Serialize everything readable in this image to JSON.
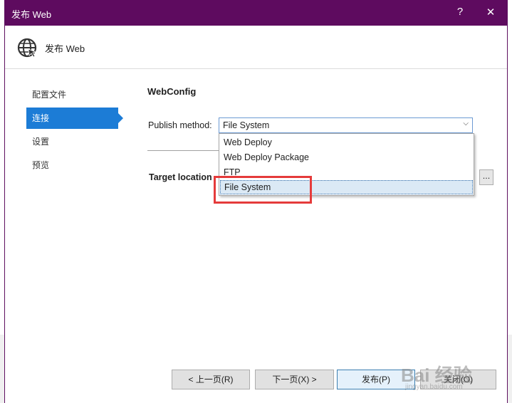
{
  "window": {
    "title": "发布 Web",
    "help_glyph": "?",
    "close_glyph": "✕"
  },
  "header": {
    "text": "发布 Web",
    "icon": "globe-icon"
  },
  "nav": {
    "items": [
      {
        "label": "配置文件"
      },
      {
        "label": "连接",
        "active": true
      },
      {
        "label": "设置"
      },
      {
        "label": "预览"
      }
    ]
  },
  "main": {
    "section_title": "WebConfig",
    "publish_method_label": "Publish method:",
    "publish_method_value": "File System",
    "target_location_label": "Target location",
    "browse_label": "...",
    "dropdown_options": [
      "Web Deploy",
      "Web Deploy Package",
      "FTP",
      "File System"
    ],
    "selected_option": "File System"
  },
  "footer": {
    "prev": "< 上一页(R)",
    "next": "下一页(X) >",
    "publish": "发布(P)",
    "close": "关闭(O)"
  },
  "watermark": {
    "text": "Bai 经验",
    "sub": "jingyan.baidu.com"
  },
  "colors": {
    "titlebar": "#5e0b5f",
    "nav_active": "#1c7cd6",
    "highlight": "#e53b3b"
  }
}
